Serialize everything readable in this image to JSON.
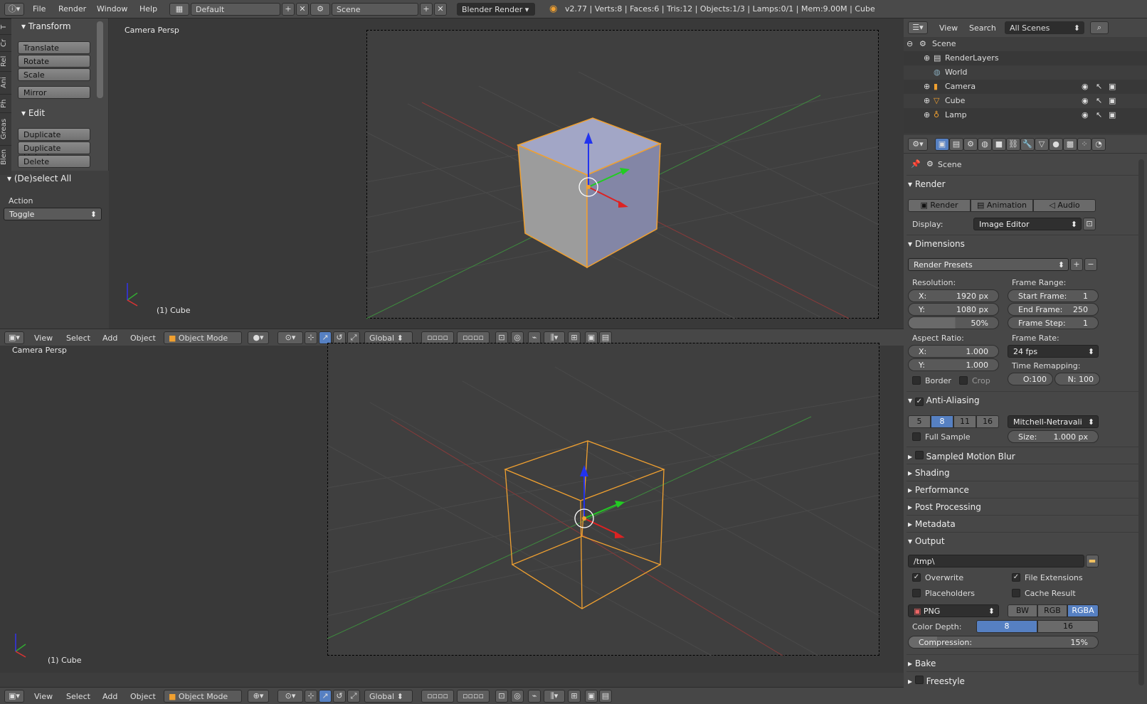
{
  "topbar": {
    "menus": [
      "File",
      "Render",
      "Window",
      "Help"
    ],
    "screen_layout": "Default",
    "scene": "Scene",
    "engine": "Blender Render",
    "stats": "v2.77 | Verts:8 | Faces:6 | Tris:12 | Objects:1/3 | Lamps:0/1 | Mem:9.00M | Cube"
  },
  "toolshelf": {
    "tabs": [
      "T",
      "Cr",
      "Rel",
      "Ani",
      "Ph",
      "Greas",
      "Blen"
    ],
    "transform_title": "Transform",
    "transform_buttons": [
      "Translate",
      "Rotate",
      "Scale"
    ],
    "mirror": "Mirror",
    "edit_title": "Edit",
    "edit_buttons": [
      "Duplicate",
      "Duplicate Linked",
      "Delete"
    ],
    "operator_title": "(De)select All",
    "action_label": "Action",
    "action_value": "Toggle"
  },
  "viewport_top": {
    "label": "Camera Persp",
    "object": "(1) Cube"
  },
  "viewport_bottom": {
    "label": "Camera Persp",
    "object": "(1) Cube"
  },
  "header": {
    "view": "View",
    "select": "Select",
    "add": "Add",
    "object": "Object",
    "mode": "Object Mode",
    "orientation": "Global"
  },
  "outliner": {
    "view": "View",
    "search": "Search",
    "filter": "All Scenes",
    "items": [
      "Scene",
      "RenderLayers",
      "World",
      "Camera",
      "Cube",
      "Lamp"
    ]
  },
  "properties": {
    "context": "Scene",
    "render": {
      "title": "Render",
      "render_btn": "Render",
      "animation_btn": "Animation",
      "audio_btn": "Audio",
      "display_label": "Display:",
      "display_value": "Image Editor"
    },
    "dimensions": {
      "title": "Dimensions",
      "presets": "Render Presets",
      "resolution_label": "Resolution:",
      "res_x_key": "X:",
      "res_x": "1920 px",
      "res_y_key": "Y:",
      "res_y": "1080 px",
      "res_pct": "50%",
      "frame_range_label": "Frame Range:",
      "start_key": "Start Frame:",
      "start": "1",
      "end_key": "End Frame:",
      "end": "250",
      "step_key": "Frame Step:",
      "step": "1",
      "aspect_label": "Aspect Ratio:",
      "asp_x_key": "X:",
      "asp_x": "1.000",
      "asp_y_key": "Y:",
      "asp_y": "1.000",
      "frame_rate_label": "Frame Rate:",
      "frame_rate": "24 fps",
      "remap_label": "Time Remapping:",
      "remap_old": "O:100",
      "remap_new": "N: 100",
      "border": "Border",
      "crop": "Crop"
    },
    "antialiasing": {
      "title": "Anti-Aliasing",
      "samples": [
        "5",
        "8",
        "11",
        "16"
      ],
      "filter": "Mitchell-Netravali",
      "full_sample": "Full Sample",
      "size_key": "Size:",
      "size": "1.000 px"
    },
    "collapsed": [
      "Sampled Motion Blur",
      "Shading",
      "Performance",
      "Post Processing",
      "Metadata"
    ],
    "output": {
      "title": "Output",
      "path": "/tmp\\",
      "overwrite": "Overwrite",
      "file_extensions": "File Extensions",
      "placeholders": "Placeholders",
      "cache_result": "Cache Result",
      "format": "PNG",
      "bw": "BW",
      "rgb": "RGB",
      "rgba": "RGBA",
      "color_depth_label": "Color Depth:",
      "depth_8": "8",
      "depth_16": "16",
      "compression_label": "Compression:",
      "compression": "15%"
    },
    "bake": "Bake",
    "freestyle": "Freestyle"
  }
}
